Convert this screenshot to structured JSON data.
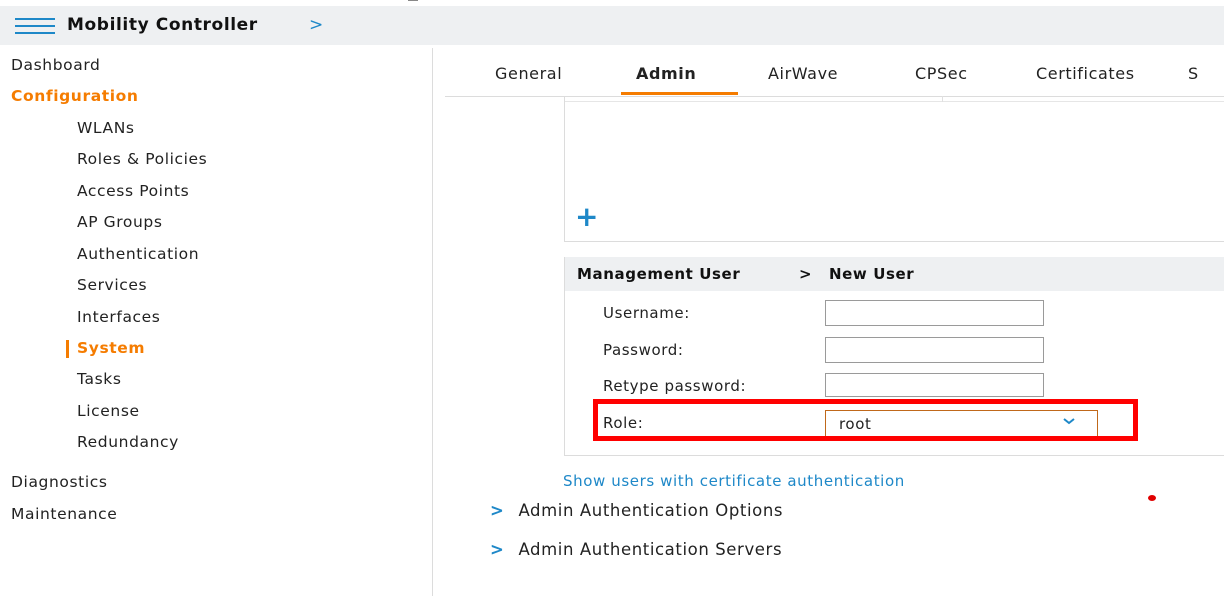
{
  "header": {
    "title": "Mobility Controller",
    "chevron": ">"
  },
  "sidebar": {
    "top_items": [
      "Dashboard",
      "Configuration"
    ],
    "sub_items": [
      "WLANs",
      "Roles & Policies",
      "Access Points",
      "AP Groups",
      "Authentication",
      "Services",
      "Interfaces",
      "System",
      "Tasks",
      "License",
      "Redundancy"
    ],
    "bottom_items": [
      "Diagnostics",
      "Maintenance"
    ],
    "active_section": "Configuration",
    "active_item": "System"
  },
  "tabs": [
    "General",
    "Admin",
    "AirWave",
    "CPSec",
    "Certificates",
    "S"
  ],
  "active_tab": "Admin",
  "upper_panel": {
    "add_icon": "plus-icon",
    "add_glyph": "+"
  },
  "new_user": {
    "breadcrumb_parent": "Management User",
    "breadcrumb_sep": ">",
    "breadcrumb_current": "New User",
    "fields": {
      "username_label": "Username:",
      "username_value": "",
      "password_label": "Password:",
      "password_value": "",
      "retype_label": "Retype password:",
      "retype_value": "",
      "role_label": "Role:",
      "role_value": "root"
    }
  },
  "cert_link": "Show users with certificate authentication",
  "sections": [
    "Admin Authentication Options",
    "Admin Authentication Servers"
  ],
  "section_chevron": ">",
  "colors": {
    "accent": "#f57c00",
    "link": "#1e88c8",
    "highlight": "#ff0000",
    "header_bg": "#eef0f2"
  }
}
